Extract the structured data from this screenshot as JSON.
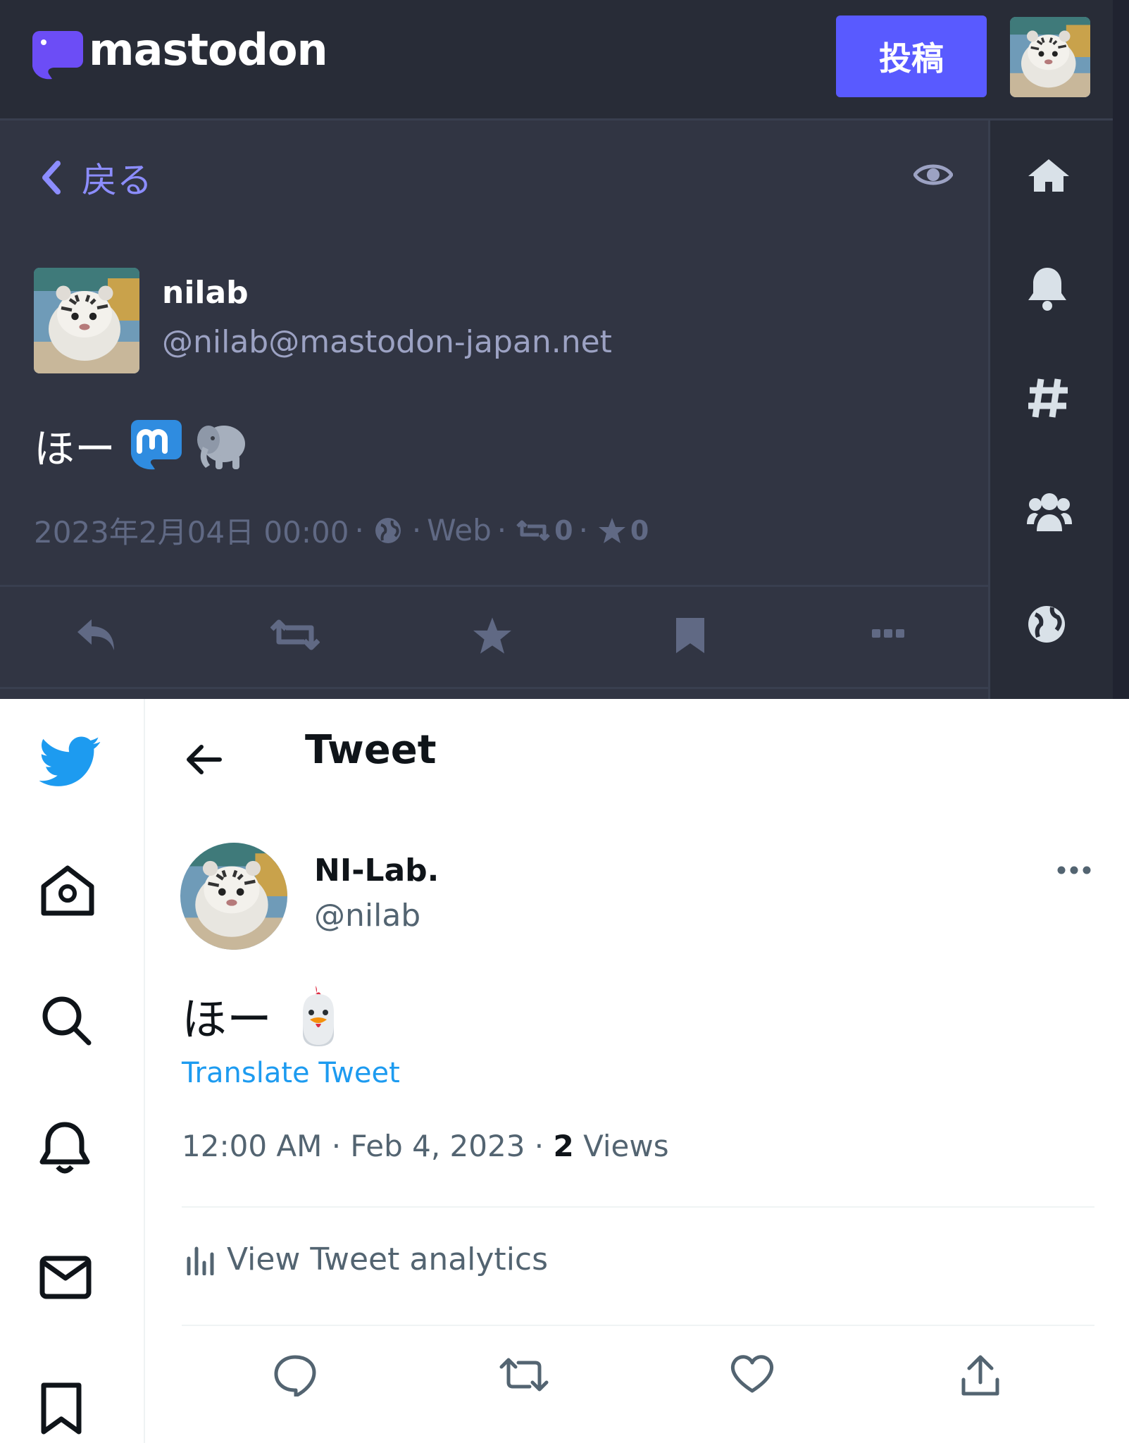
{
  "mastodon": {
    "logo_text": "mastodon",
    "compose_button": "投稿",
    "back_label": "戻る",
    "status": {
      "display_name": "nilab",
      "account": "@nilab@mastodon-japan.net",
      "text": "ほー",
      "emojis": [
        "mastodon-logo-emoji",
        "elephant-emoji"
      ],
      "date": "2023年2月04日 00:00",
      "separator": "·",
      "visibility_icon": "globe-icon",
      "application": "Web",
      "reblogs_count": "0",
      "favourites_count": "0"
    },
    "actions": [
      "reply-icon",
      "boost-icon",
      "favourite-icon",
      "bookmark-icon",
      "more-icon"
    ],
    "nav": [
      "home-icon",
      "bell-icon",
      "hashtag-icon",
      "users-icon",
      "globe-icon"
    ],
    "colors": {
      "background": "#282c37",
      "column": "#313543",
      "accent": "#595aff",
      "link": "#8c8dff",
      "muted": "#606984"
    }
  },
  "twitter": {
    "header_title": "Tweet",
    "author": {
      "name": "NI-Lab.",
      "handle": "@nilab"
    },
    "tweet_text": "ほー",
    "tweet_emoji": "chicken-emoji",
    "translate_link": "Translate Tweet",
    "timestamp": "12:00 AM · Feb 4, 2023 · ",
    "views_count": "2",
    "views_label": " Views",
    "analytics_label": "View Tweet analytics",
    "nav": [
      "twitter-bird-icon",
      "home-icon",
      "search-icon",
      "bell-icon",
      "mail-icon",
      "bookmark-icon"
    ],
    "actions": [
      "reply-icon",
      "retweet-icon",
      "like-icon",
      "share-icon"
    ],
    "colors": {
      "brand": "#1d9bf0",
      "text": "#0f1419",
      "muted": "#536471"
    }
  }
}
